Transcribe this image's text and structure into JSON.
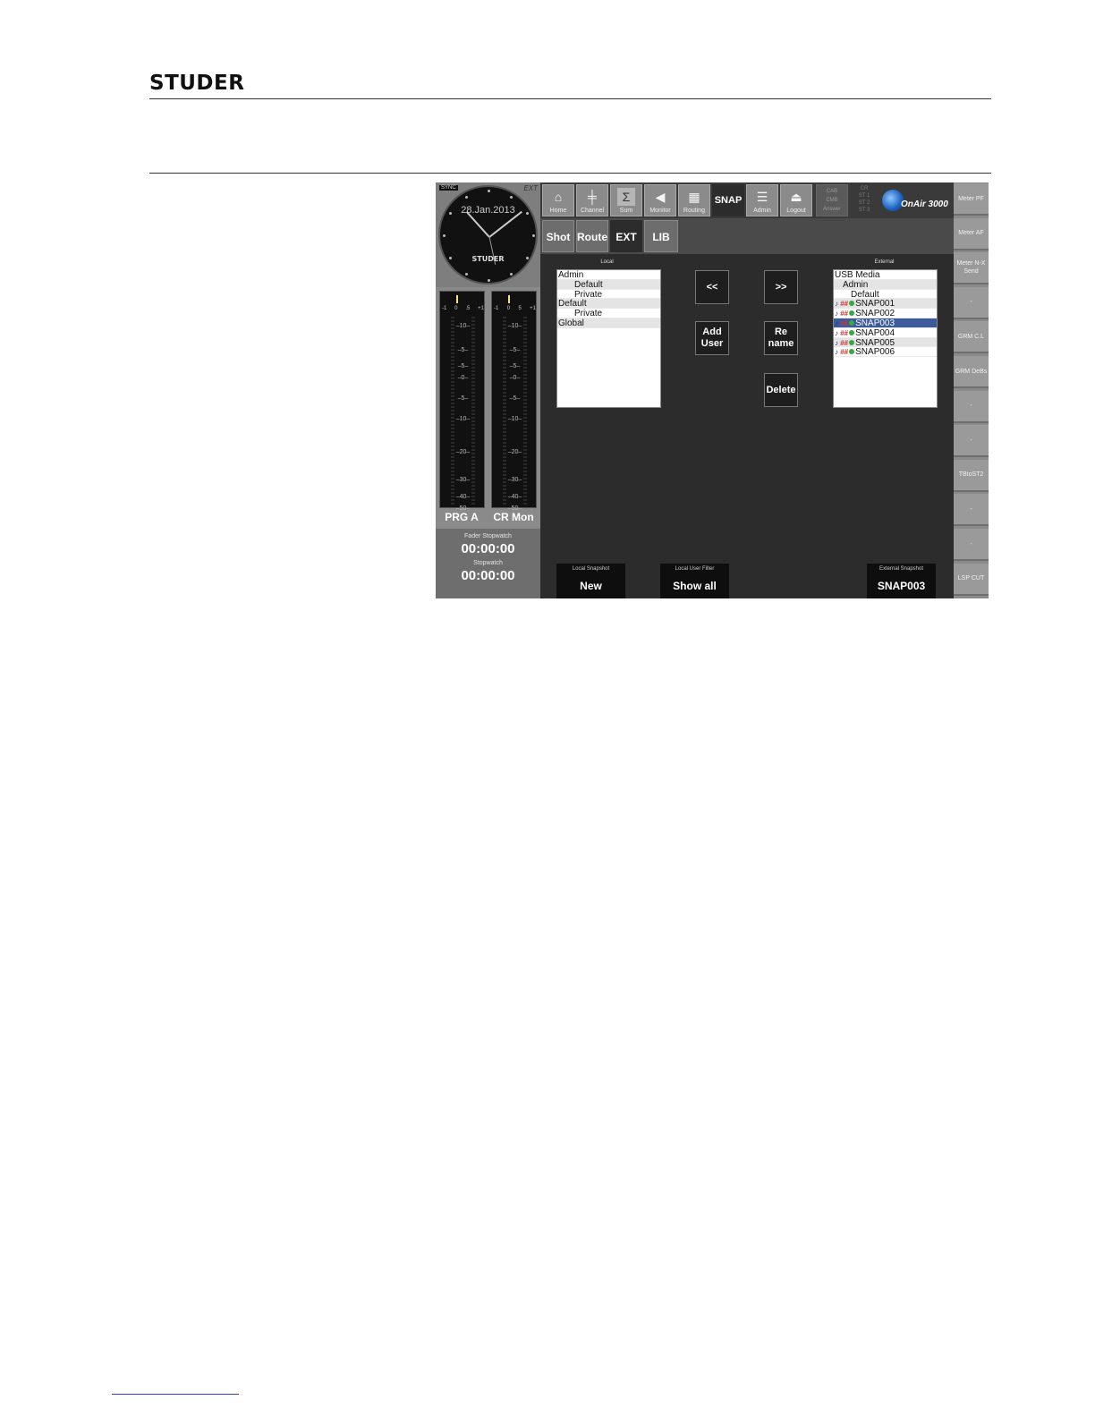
{
  "doc": {
    "logo": "STUDER"
  },
  "clock": {
    "sync": "SYNC",
    "ext": "EXT",
    "date": "28.Jan.2013",
    "brand": "STUDER"
  },
  "meters": [
    {
      "label": "PRG A",
      "scale": [
        "-1",
        "0",
        ".5",
        "+1"
      ]
    },
    {
      "label": "CR Mon",
      "scale": [
        "-1",
        "0",
        "5",
        "+1"
      ]
    }
  ],
  "meter_marks": [
    "10",
    "5",
    "5",
    "0",
    "5",
    "10",
    "20",
    "30",
    "40",
    "50"
  ],
  "stopwatch": {
    "fader_label": "Fader Stopwatch",
    "fader_value": "00:00:00",
    "label": "Stopwatch",
    "value": "00:00:00"
  },
  "toolbar": {
    "buttons": [
      {
        "label": "Home",
        "icon": "home-icon",
        "glyph": "⌂"
      },
      {
        "label": "Channel",
        "icon": "channel-fader-icon",
        "glyph": "╪"
      },
      {
        "label": "Sum",
        "icon": "sum-sigma-icon",
        "glyph": "Σ"
      },
      {
        "label": "Monitor",
        "icon": "speaker-icon",
        "glyph": "◀"
      },
      {
        "label": "Routing",
        "icon": "routing-grid-icon",
        "glyph": "▦"
      },
      {
        "label": "SNAP",
        "icon": "",
        "glyph": ""
      },
      {
        "label": "Admin",
        "icon": "admin-list-icon",
        "glyph": "☰"
      },
      {
        "label": "Logout",
        "icon": "logout-icon",
        "glyph": "⏏"
      }
    ],
    "dim_group_a": [
      "CAB",
      "CMB",
      "Answer"
    ],
    "dim_group_b": [
      "CR",
      "ST 1",
      "ST 2",
      "ST 3"
    ],
    "product": "OnAir 3000"
  },
  "tabs": [
    "Shot",
    "Route",
    "EXT",
    "LIB"
  ],
  "selected_tab": "EXT",
  "side_buttons": [
    "Meter PF",
    "Meter AF",
    "Meter N-X Send",
    "-",
    "GRM C.L",
    "GRM DeBs",
    "-",
    "-",
    "TBtoST2",
    "-",
    "-",
    "LSP CUT"
  ],
  "local": {
    "title": "Local",
    "items": [
      {
        "text": "Admin",
        "indent": 0
      },
      {
        "text": "Default",
        "indent": 2
      },
      {
        "text": "Private",
        "indent": 2
      },
      {
        "text": "Default",
        "indent": 0
      },
      {
        "text": "Private",
        "indent": 2
      },
      {
        "text": "Global",
        "indent": 0
      }
    ]
  },
  "external": {
    "title": "External",
    "items": [
      {
        "text": "USB Media",
        "indent": 0,
        "snap": false
      },
      {
        "text": "Admin",
        "indent": 1,
        "snap": false
      },
      {
        "text": "Default",
        "indent": 2,
        "snap": false
      },
      {
        "text": "SNAP001",
        "indent": 0,
        "snap": true
      },
      {
        "text": "SNAP002",
        "indent": 0,
        "snap": true
      },
      {
        "text": "SNAP003",
        "indent": 0,
        "snap": true,
        "selected": true
      },
      {
        "text": "SNAP004",
        "indent": 0,
        "snap": true
      },
      {
        "text": "SNAP005",
        "indent": 0,
        "snap": true
      },
      {
        "text": "SNAP006",
        "indent": 0,
        "snap": true
      }
    ]
  },
  "actions": {
    "copy_left": "<<",
    "copy_right": ">>",
    "add_user": "Add User",
    "rename": "Re name",
    "delete": "Delete"
  },
  "bottom": {
    "local_snapshot_label": "Local Snapshot",
    "local_snapshot_value": "New",
    "filter_label": "Local User Filter",
    "filter_value": "Show all",
    "external_snapshot_label": "External Snapshot",
    "external_snapshot_value": "SNAP003"
  },
  "colors": {
    "selection": "#3d5a9a",
    "panel_bg": "#2c2c2c",
    "chrome": "#8a8a8a"
  }
}
